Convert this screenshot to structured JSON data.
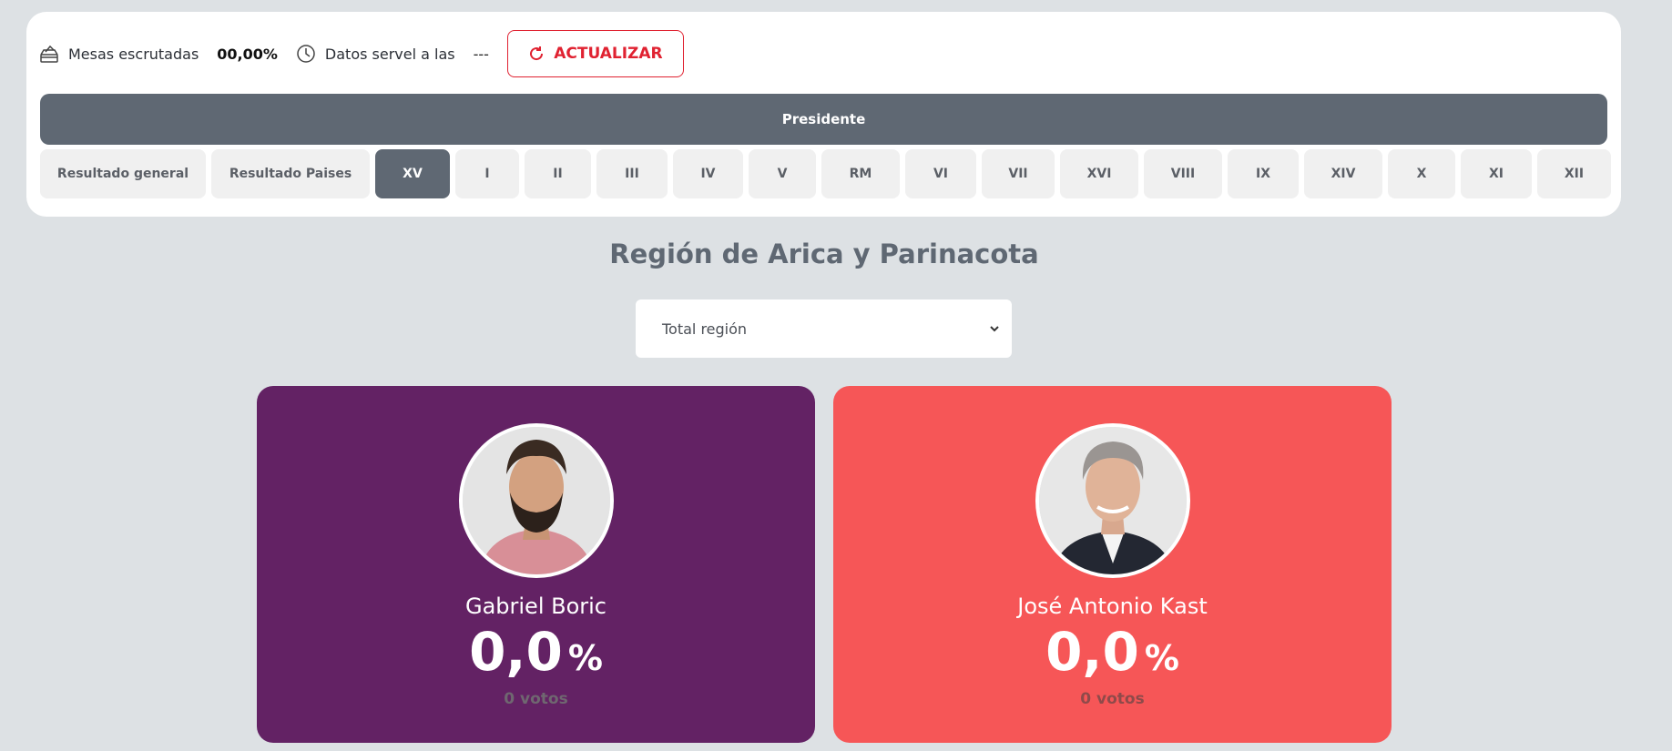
{
  "status": {
    "mesas_label": "Mesas escrutadas",
    "mesas_value": "00,00%",
    "datos_label": "Datos servel a las",
    "datos_value": "---",
    "refresh_label": "ACTUALIZAR"
  },
  "tab": {
    "label": "Presidente"
  },
  "regions": [
    "Resultado general",
    "Resultado Paises",
    "XV",
    "I",
    "II",
    "III",
    "IV",
    "V",
    "RM",
    "VI",
    "VII",
    "XVI",
    "VIII",
    "IX",
    "XIV",
    "X",
    "XI",
    "XII"
  ],
  "active_region": "XV",
  "region_title": "Región de Arica y Parinacota",
  "select": {
    "value": "Total región"
  },
  "candidates": [
    {
      "name": "Gabriel Boric",
      "pct": "0,0",
      "pct_symbol": "%",
      "votes": "0 votos",
      "color": "#632264"
    },
    {
      "name": "José Antonio Kast",
      "pct": "0,0",
      "pct_symbol": "%",
      "votes": "0 votos",
      "color": "#f65657"
    }
  ],
  "colors": {
    "accent": "#e02231",
    "tab_bg": "#5f6873",
    "page_bg": "#dde1e4"
  }
}
